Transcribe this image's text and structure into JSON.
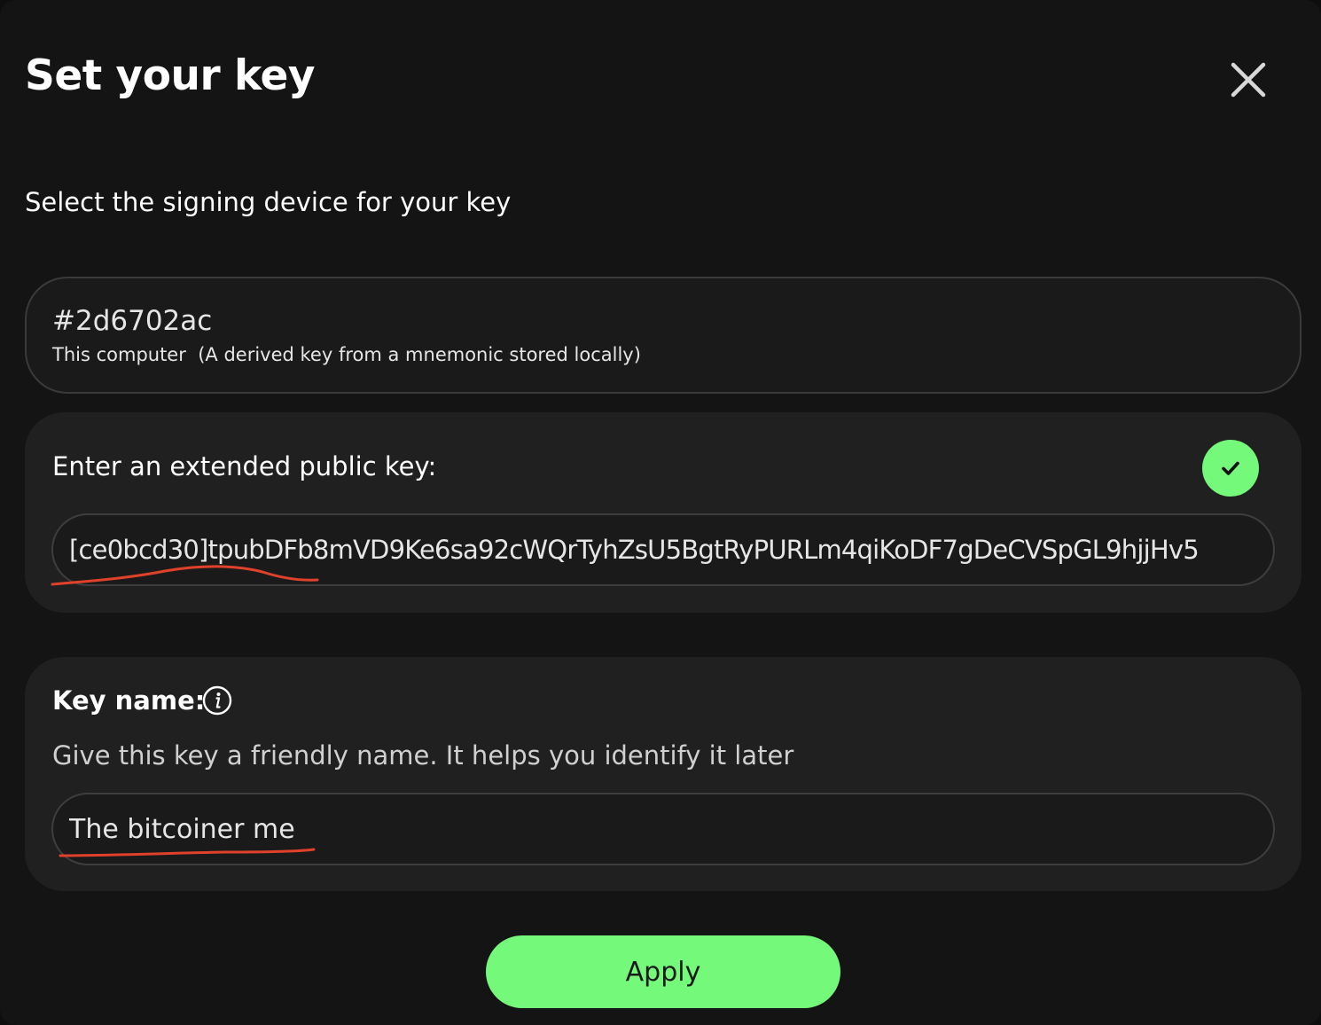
{
  "modal": {
    "title": "Set your key",
    "close_icon": "close-icon"
  },
  "device_selection": {
    "prompt": "Select the signing device for your key",
    "option": {
      "fingerprint": "#2d6702ac",
      "description": "This computer  (A derived key from a mnemonic stored locally)"
    }
  },
  "xpub": {
    "label": "Enter an extended public key:",
    "value": "[ce0bcd30]tpubDFb8mVD9Ke6sa92cWQrTyhZsU5BgtRyPURLm4qiKoDF7gDeCVSpGL9hjjHv5",
    "status_icon": "check-icon",
    "status_color": "#74f97a"
  },
  "key_name": {
    "label": "Key name:",
    "info_icon": "info-icon",
    "help": "Give this key a friendly name. It helps you identify it later",
    "value": "The bitcoiner me"
  },
  "actions": {
    "apply_label": "Apply",
    "accent_color": "#74f97a"
  },
  "annotations": {
    "underline_color": "#e0412a"
  }
}
